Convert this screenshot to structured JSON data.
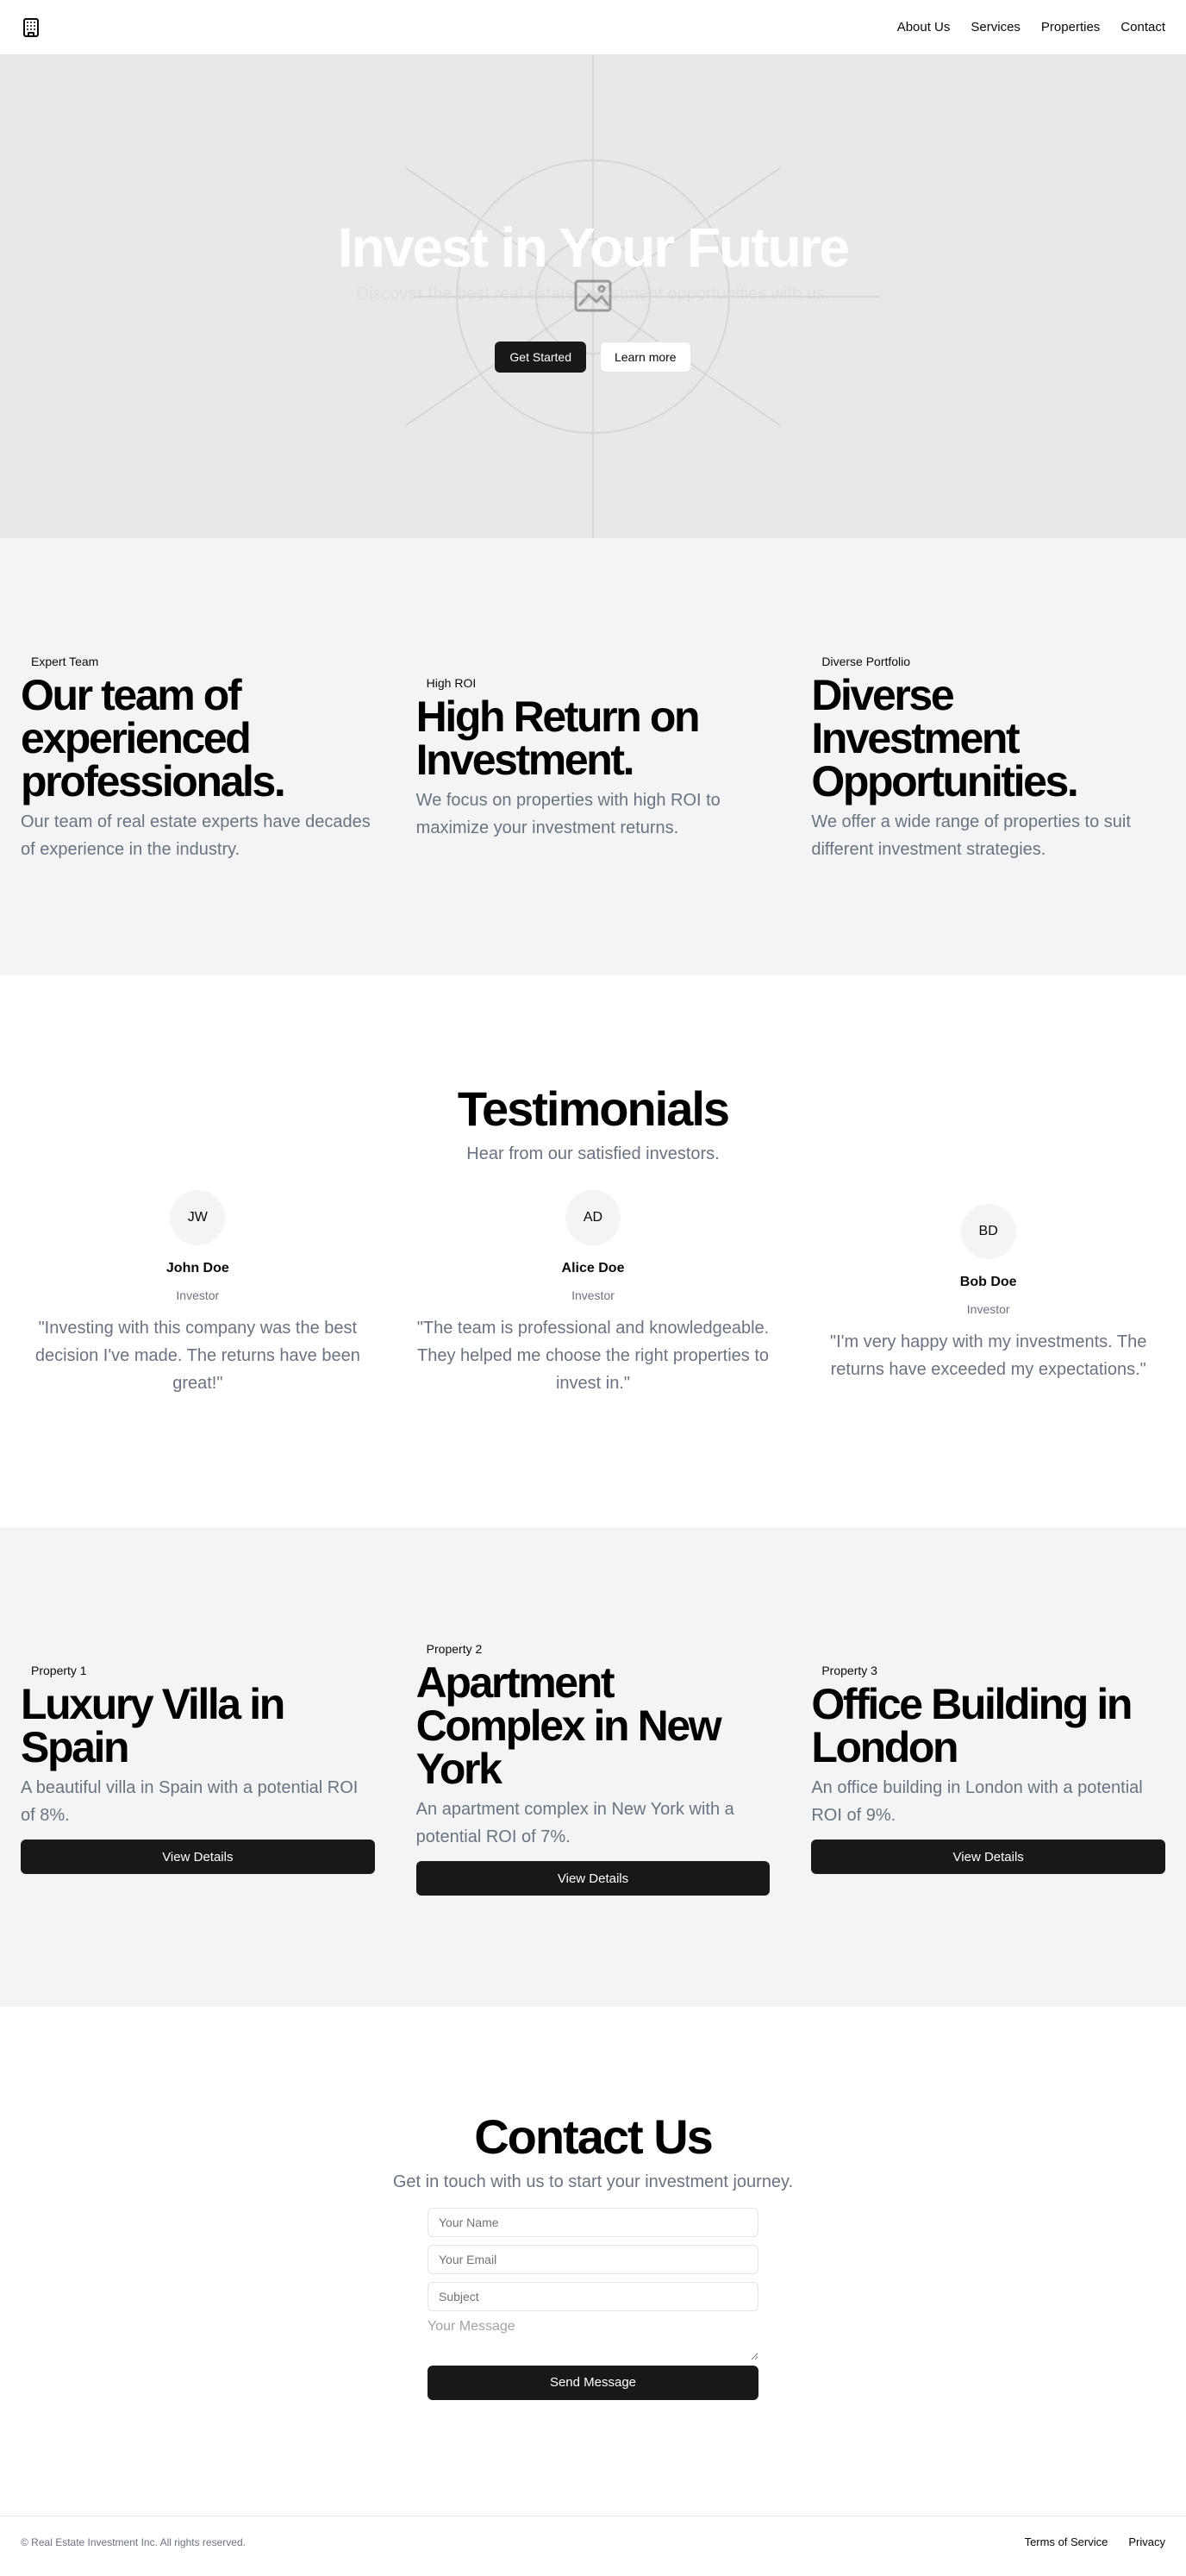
{
  "nav": {
    "logo_icon": "building-icon",
    "links": [
      "About Us",
      "Services",
      "Properties",
      "Contact"
    ]
  },
  "hero": {
    "title": "Invest in Your Future",
    "subtitle": "Discover the best real estate investment opportunities with us.",
    "primary_button": "Get Started",
    "secondary_button": "Learn more",
    "placeholder_icon": "image-placeholder-icon"
  },
  "features": [
    {
      "badge": "Expert Team",
      "title": "Our team of experienced professionals.",
      "text": "Our team of real estate experts have decades of experience in the industry."
    },
    {
      "badge": "High ROI",
      "title": "High Return on Investment.",
      "text": "We focus on properties with high ROI to maximize your investment returns."
    },
    {
      "badge": "Diverse Portfolio",
      "title": "Diverse Investment Opportunities.",
      "text": "We offer a wide range of properties to suit different investment strategies."
    }
  ],
  "testimonials": {
    "title": "Testimonials",
    "subtitle": "Hear from our satisfied investors.",
    "items": [
      {
        "initials": "JW",
        "name": "John Doe",
        "role": "Investor",
        "quote": "\"Investing with this company was the best decision I've made. The returns have been great!\""
      },
      {
        "initials": "AD",
        "name": "Alice Doe",
        "role": "Investor",
        "quote": "\"The team is professional and knowledgeable. They helped me choose the right properties to invest in.\""
      },
      {
        "initials": "BD",
        "name": "Bob Doe",
        "role": "Investor",
        "quote": "\"I'm very happy with my investments. The returns have exceeded my expectations.\""
      }
    ]
  },
  "properties": [
    {
      "badge": "Property 1",
      "title": "Luxury Villa in Spain",
      "text": "A beautiful villa in Spain with a potential ROI of 8%.",
      "button": "View Details"
    },
    {
      "badge": "Property 2",
      "title": "Apartment Complex in New York",
      "text": "An apartment complex in New York with a potential ROI of 7%.",
      "button": "View Details"
    },
    {
      "badge": "Property 3",
      "title": "Office Building in London",
      "text": "An office building in London with a potential ROI of 9%.",
      "button": "View Details"
    }
  ],
  "contact": {
    "title": "Contact Us",
    "subtitle": "Get in touch with us to start your investment journey.",
    "name_placeholder": "Your Name",
    "email_placeholder": "Your Email",
    "subject_placeholder": "Subject",
    "message_placeholder": "Your Message",
    "submit": "Send Message"
  },
  "footer": {
    "copyright": "© Real Estate Investment Inc. All rights reserved.",
    "links": [
      "Terms of Service",
      "Privacy"
    ]
  },
  "colors": {
    "primary": "#18181b",
    "muted_text": "#6b7280",
    "section_bg": "#f3f4f6",
    "hero_bg": "#e8e8e8"
  }
}
